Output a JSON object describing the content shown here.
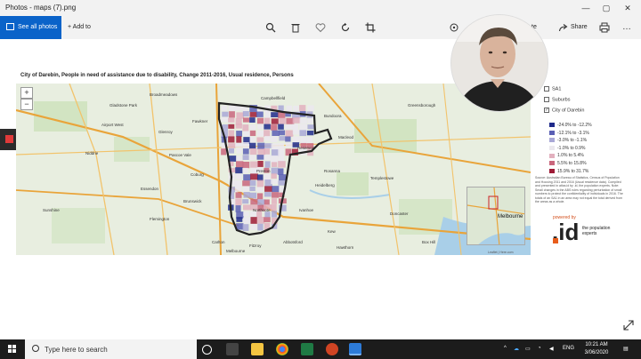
{
  "window": {
    "title": "Photos - maps (7).png",
    "controls": [
      "—",
      "▢",
      "✕"
    ]
  },
  "toolbar": {
    "see_all_label": "See all photos",
    "add_to_label": "Add to",
    "share_label": "Share",
    "partial_label": "te"
  },
  "map": {
    "title": "City of Darebin, People in need of assistance due to disability, Change 2011-2016, Usual residence, Persons",
    "zoom_in": "+",
    "zoom_out": "−",
    "attribution": "Leaflet | Here.com",
    "minimap_label": "Melbourne"
  },
  "layers": [
    {
      "label": "SA1",
      "checked": false
    },
    {
      "label": "Suburbs",
      "checked": false
    },
    {
      "label": "City of Darebin",
      "checked": true
    }
  ],
  "legend": [
    {
      "label": "-24.0% to -12.2%",
      "color": "#1f2a8a"
    },
    {
      "label": "-12.1% to -3.1%",
      "color": "#5a5fb4"
    },
    {
      "label": "-3.0% to -1.1%",
      "color": "#a9a8d6"
    },
    {
      "label": "-1.0% to 0.9%",
      "color": "#ebe8ee"
    },
    {
      "label": "1.0% to 5.4%",
      "color": "#e2b0be"
    },
    {
      "label": "5.5% to 15.8%",
      "color": "#c9667c"
    },
    {
      "label": "15.9% to 31.7%",
      "color": "#9e1b36"
    }
  ],
  "source_note": "Source: Australian Bureau of Statistics, Census of Population and Housing 2011 and 2016 (Usual residence data). Compiled and presented in atlas.id by .id, the population experts. Note: Small changes in the ABS rules regarding perturbation of small numbers to protect the confidentiality of individuals in 2016. The totals of an SA1 in an area may not equal the total derived from the areas as a whole.",
  "logo": {
    "powered_by": "powered by",
    "brand": ".id",
    "tagline": "the population experts"
  },
  "map_labels": [
    "Gladstone Park",
    "Broadmeadows",
    "Campbellfield",
    "Bundoora",
    "Greensborough",
    "Airport West",
    "Glenroy",
    "Fawkner",
    "Reservoir",
    "Macleod",
    "Rosanna",
    "Niddrie",
    "Pascoe Vale",
    "Coburg",
    "Preston",
    "Heidelberg",
    "Templestowe",
    "Essendon",
    "Brunswick",
    "Northcote",
    "Ivanhoe",
    "Kew",
    "Doncaster",
    "Flemington",
    "Carlton",
    "Fitzroy",
    "Abbotsford",
    "Hawthorn",
    "Box Hill",
    "Melbourne",
    "Sunshine"
  ],
  "taskbar": {
    "search_placeholder": "Type here to search",
    "language": "ENG",
    "time": "10:21 AM",
    "date": "3/06/2020"
  },
  "icons": [
    "zoom-icon",
    "delete-icon",
    "favorite-icon",
    "rotate-icon",
    "crop-icon",
    "print-icon",
    "share-icon",
    "expand-icon"
  ]
}
